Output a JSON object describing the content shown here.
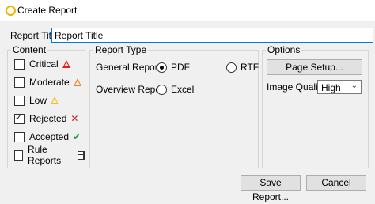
{
  "window": {
    "title": "Create Report"
  },
  "report_title": {
    "label": "Report Title",
    "value": "Report Title"
  },
  "content": {
    "title": "Content",
    "items": [
      {
        "label": "Critical",
        "checked": false,
        "icon": "red-triangle-icon"
      },
      {
        "label": "Moderate",
        "checked": false,
        "icon": "orange-triangle-icon"
      },
      {
        "label": "Low",
        "checked": false,
        "icon": "yellow-triangle-icon"
      },
      {
        "label": "Rejected",
        "checked": true,
        "icon": "red-x-icon"
      },
      {
        "label": "Accepted",
        "checked": false,
        "icon": "green-check-icon"
      },
      {
        "label": "Rule Reports",
        "checked": false,
        "icon": "table-grid-icon"
      }
    ]
  },
  "report_type": {
    "title": "Report Type",
    "general": {
      "label": "General Report",
      "options": [
        "PDF",
        "RTF"
      ],
      "selected": "PDF"
    },
    "overview": {
      "label": "Overview Report",
      "options": [
        "Excel"
      ]
    }
  },
  "options": {
    "title": "Options",
    "page_setup_label": "Page Setup...",
    "image_quality_label": "Image Quality",
    "image_quality_value": "High"
  },
  "buttons": {
    "save": "Save Report...",
    "cancel": "Cancel"
  },
  "colors": {
    "critical": "#e02020",
    "moderate": "#f08020",
    "low": "#f0c020",
    "rejected": "#d42020",
    "accepted": "#20a030",
    "focus": "#0078d7"
  }
}
